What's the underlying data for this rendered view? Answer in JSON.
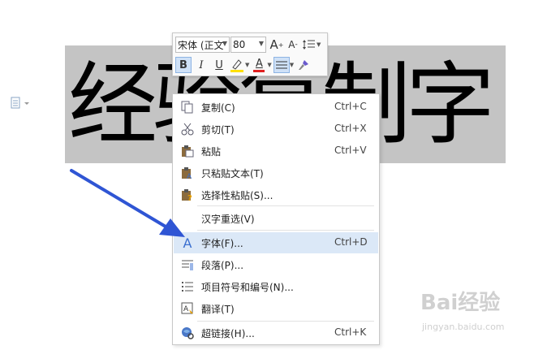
{
  "document": {
    "heading_text": "经验复制字"
  },
  "toolbar": {
    "font_name": "宋体 (正文",
    "font_size": "80",
    "grow_font": "A",
    "shrink_font": "A",
    "bold": "B",
    "italic": "I",
    "underline": "U",
    "font_color": "A"
  },
  "context_menu": {
    "items": [
      {
        "label": "复制(C)",
        "shortcut": "Ctrl+C",
        "icon": "copy-icon"
      },
      {
        "label": "剪切(T)",
        "shortcut": "Ctrl+X",
        "icon": "scissors-icon"
      },
      {
        "label": "粘贴",
        "shortcut": "Ctrl+V",
        "icon": "paste-icon"
      },
      {
        "label": "只粘贴文本(T)",
        "shortcut": "",
        "icon": "paste-text-icon"
      },
      {
        "label": "选择性粘贴(S)...",
        "shortcut": "",
        "icon": "paste-special-icon"
      },
      {
        "label": "汉字重选(V)",
        "shortcut": "",
        "icon": ""
      },
      {
        "label": "字体(F)...",
        "shortcut": "Ctrl+D",
        "icon": "font-icon"
      },
      {
        "label": "段落(P)...",
        "shortcut": "",
        "icon": "paragraph-icon"
      },
      {
        "label": "项目符号和编号(N)...",
        "shortcut": "",
        "icon": "bullet-list-icon"
      },
      {
        "label": "翻译(T)",
        "shortcut": "",
        "icon": "translate-icon"
      },
      {
        "label": "超链接(H)...",
        "shortcut": "Ctrl+K",
        "icon": "hyperlink-icon"
      }
    ],
    "highlighted_item": "字体(F)..."
  },
  "watermark": {
    "main": "Bai经验",
    "sub": "jingyan.baidu.com"
  },
  "colors": {
    "selection_bg": "#c4c4c4",
    "menu_hover": "#dbe8f7",
    "arrow": "#2f55d4",
    "accent_icon": "#3a6fd0"
  }
}
